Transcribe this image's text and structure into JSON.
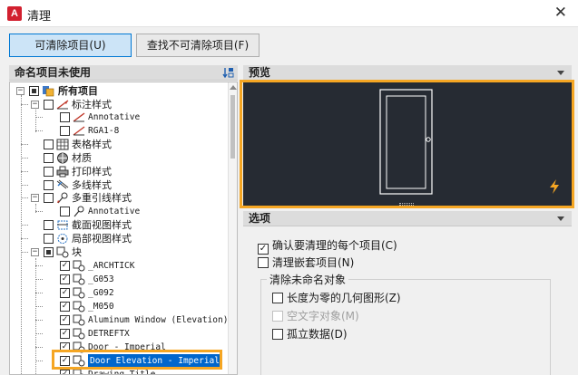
{
  "window": {
    "title": "清理",
    "app_icon": "A",
    "close_glyph": "✕"
  },
  "tabs": [
    {
      "label": "可清除项目(U)",
      "active": true
    },
    {
      "label": "查找不可清除项目(F)",
      "active": false
    }
  ],
  "tree_panel": {
    "header": "命名项目未使用",
    "items": [
      {
        "label": "所有项目",
        "mono": false,
        "bold": true
      },
      {
        "label": "标注样式",
        "mono": false
      },
      {
        "label": "Annotative",
        "mono": true
      },
      {
        "label": "RGA1-8",
        "mono": true
      },
      {
        "label": "表格样式",
        "mono": false
      },
      {
        "label": "材质",
        "mono": false
      },
      {
        "label": "打印样式",
        "mono": false
      },
      {
        "label": "多线样式",
        "mono": false
      },
      {
        "label": "多重引线样式",
        "mono": false
      },
      {
        "label": "Annotative",
        "mono": true
      },
      {
        "label": "截面视图样式",
        "mono": false
      },
      {
        "label": "局部视图样式",
        "mono": false
      },
      {
        "label": "块",
        "mono": false
      },
      {
        "label": "_ARCHTICK",
        "mono": true
      },
      {
        "label": "_G053",
        "mono": true
      },
      {
        "label": "_G092",
        "mono": true
      },
      {
        "label": "_M050",
        "mono": true
      },
      {
        "label": "Aluminum Window (Elevation)",
        "mono": true
      },
      {
        "label": "DETREFTX",
        "mono": true
      },
      {
        "label": "Door - Imperial",
        "mono": true
      },
      {
        "label": "Door Elevation - Imperial",
        "mono": true,
        "selected": true
      },
      {
        "label": "Drawing Title",
        "mono": true
      }
    ]
  },
  "preview_panel": {
    "header": "预览"
  },
  "options_panel": {
    "header": "选项",
    "confirm": {
      "label": "确认要清理的每个项目(C)",
      "checked": true
    },
    "nested": {
      "label": "清理嵌套项目(N)",
      "checked": false
    },
    "group_title": "清除未命名对象",
    "zero_length": {
      "label": "长度为零的几何图形(Z)",
      "checked": false
    },
    "empty_text": {
      "label": "空文字对象(M)",
      "checked": false,
      "disabled": true
    },
    "orphan": {
      "label": "孤立数据(D)",
      "checked": false
    }
  },
  "colors": {
    "accent_highlight": "#f5a623",
    "selection": "#0066cc",
    "preview_bg": "#262b33",
    "app_red": "#d2202f"
  }
}
